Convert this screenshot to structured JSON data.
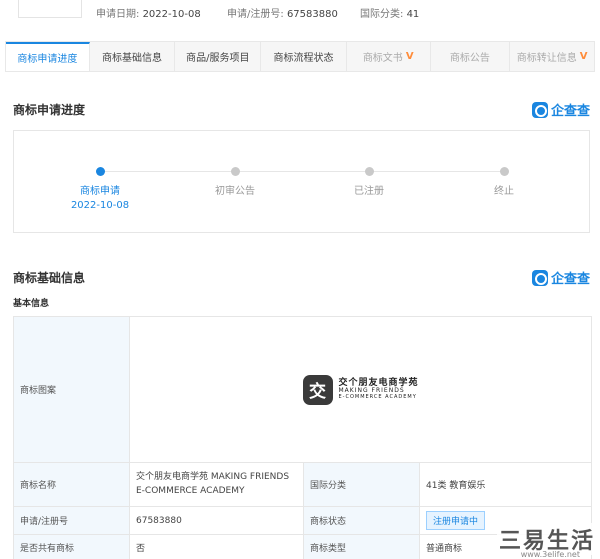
{
  "summary": {
    "apply_date_label": "申请日期:",
    "apply_date": "2022-10-08",
    "reg_no_label": "申请/注册号:",
    "reg_no": "67583880",
    "class_label": "国际分类:",
    "class_value": "41"
  },
  "tabs": [
    {
      "label": "商标申请进度"
    },
    {
      "label": "商标基础信息"
    },
    {
      "label": "商品/服务项目"
    },
    {
      "label": "商标流程状态"
    },
    {
      "label": "商标文书"
    },
    {
      "label": "商标公告"
    },
    {
      "label": "商标转让信息"
    }
  ],
  "progress_section": {
    "title": "商标申请进度",
    "brand": "企查查",
    "steps": [
      {
        "label": "商标申请",
        "date": "2022-10-08"
      },
      {
        "label": "初审公告"
      },
      {
        "label": "已注册"
      },
      {
        "label": "终止"
      }
    ]
  },
  "basic_section": {
    "title": "商标基础信息",
    "brand": "企查查",
    "subhead": "基本信息",
    "logo_label": "商标图案",
    "logo": {
      "mark": "交",
      "cn": "交个朋友电商学苑",
      "en1": "MAKING FRIENDS",
      "en2": "E-COMMERCE ACADEMY"
    },
    "name_label": "商标名称",
    "name_value": "交个朋友电商学苑 MAKING FRIENDS E-COMMERCE ACADEMY",
    "class_label": "国际分类",
    "class_value": "41类 教育娱乐",
    "regno_label": "申请/注册号",
    "regno_value": "67583880",
    "status_label": "商标状态",
    "status_value": "注册申请中",
    "shared_label": "是否共有商标",
    "shared_value": "否",
    "type_label": "商标类型",
    "type_value": "普通商标"
  },
  "watermark": {
    "main": "三易生活",
    "sub": "www.3elife.net"
  },
  "colors": {
    "accent": "#1a86e0",
    "ext": "#ff8c3a",
    "key_bg": "#f2f8fd"
  }
}
